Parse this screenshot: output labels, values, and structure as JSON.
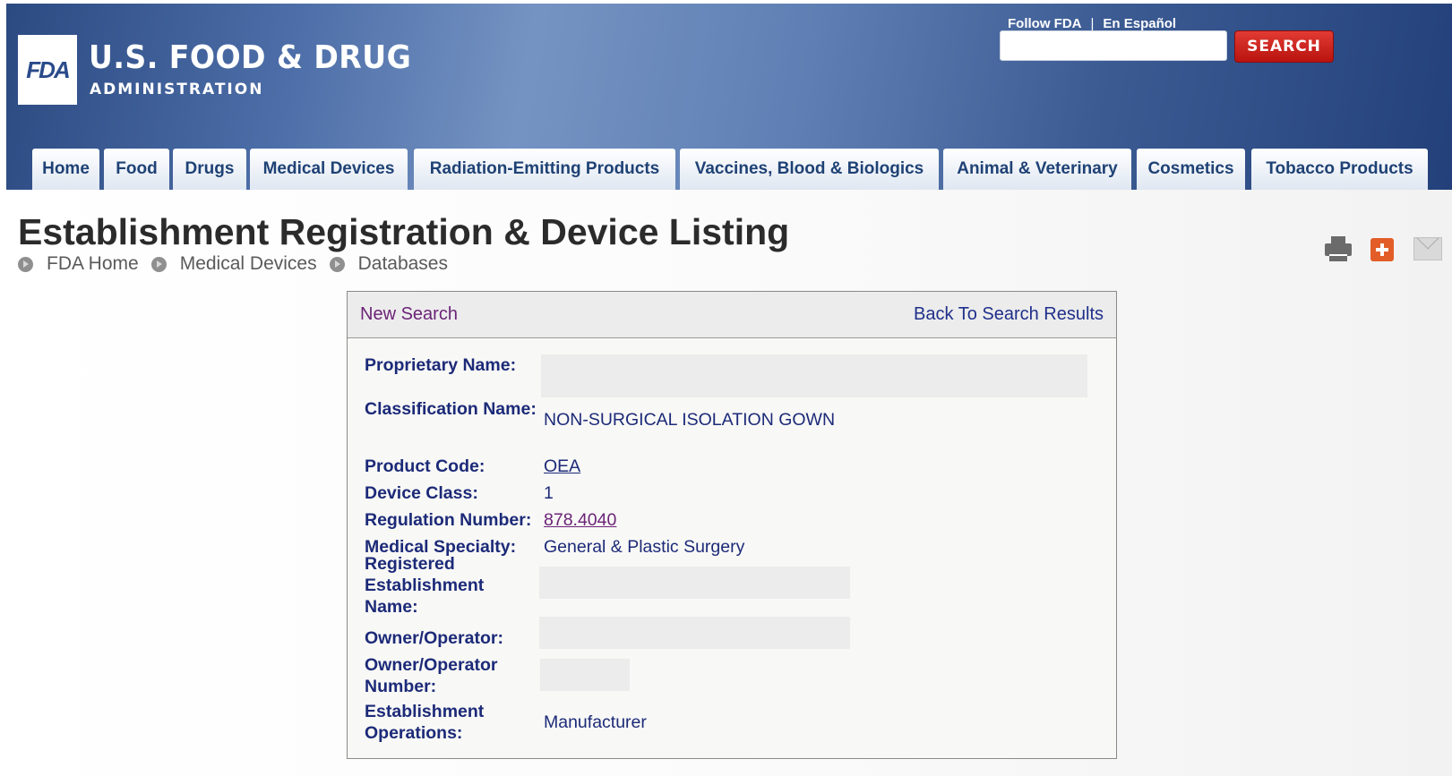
{
  "header": {
    "logo_text": "FDA",
    "agency_name": "U.S. FOOD & DRUG",
    "agency_sub": "ADMINISTRATION",
    "follow_link": "Follow FDA",
    "separator": "|",
    "espanol_link": "En Español",
    "search_placeholder": "",
    "search_button": "SEARCH"
  },
  "nav": {
    "tabs": [
      {
        "label": "Home"
      },
      {
        "label": "Food"
      },
      {
        "label": "Drugs"
      },
      {
        "label": "Medical Devices"
      },
      {
        "label": "Radiation-Emitting Products"
      },
      {
        "label": "Vaccines, Blood & Biologics"
      },
      {
        "label": "Animal & Veterinary"
      },
      {
        "label": "Cosmetics"
      },
      {
        "label": "Tobacco Products"
      }
    ]
  },
  "page": {
    "title": "Establishment Registration & Device Listing",
    "breadcrumb": [
      "FDA Home",
      "Medical Devices",
      "Databases"
    ],
    "tools": [
      "print-icon",
      "plus-icon",
      "mail-icon"
    ]
  },
  "panel": {
    "new_search": "New Search",
    "back_results": "Back To Search Results",
    "fields": {
      "proprietary_name_label": "Proprietary Name:",
      "classification_name_label": "Classification Name:",
      "classification_name_value": "NON-SURGICAL ISOLATION GOWN",
      "product_code_label": "Product Code:",
      "product_code_value": "OEA",
      "device_class_label": "Device Class:",
      "device_class_value": "1",
      "regulation_number_label": "Regulation Number:",
      "regulation_number_value": "878.4040",
      "medical_specialty_label": "Medical Specialty:",
      "medical_specialty_value": "General & Plastic Surgery",
      "registered_establishment_label": "Registered Establishment Name:",
      "owner_operator_label": "Owner/Operator:",
      "owner_operator_number_label": "Owner/Operator Number:",
      "establishment_operations_label": "Establishment Operations:",
      "establishment_operations_value": "Manufacturer"
    }
  },
  "colors": {
    "header_dark": "#23407a",
    "header_light": "#7593c2",
    "search_red": "#c8221c",
    "label_blue": "#1c2a78",
    "visited_purple": "#6b2377"
  }
}
